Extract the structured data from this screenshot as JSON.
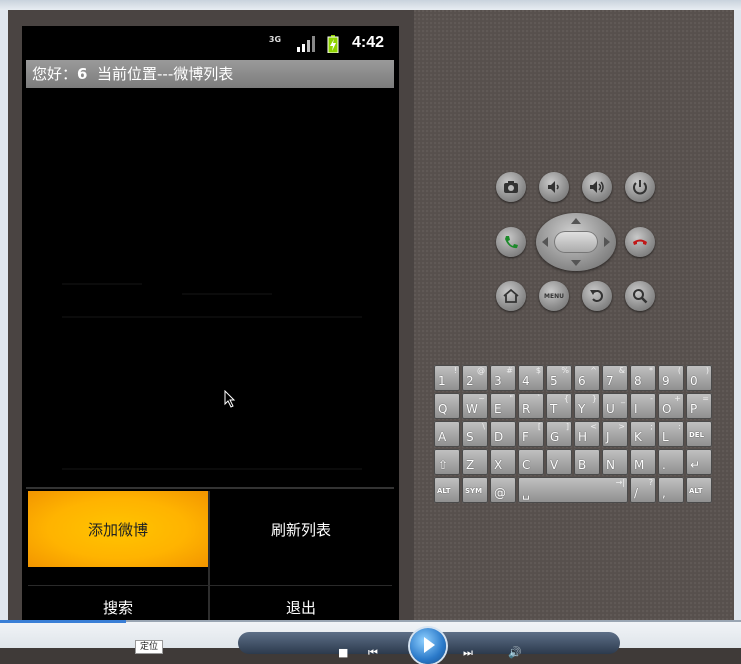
{
  "status_bar": {
    "network": "3G",
    "time": "4:42"
  },
  "title_bar": {
    "greeting": "您好：",
    "user_id": "6",
    "location": "当前位置---微博列表"
  },
  "option_menu": {
    "items": [
      {
        "label": "添加微博",
        "highlighted": true
      },
      {
        "label": "刷新列表",
        "highlighted": false
      },
      {
        "label": "搜索",
        "highlighted": false
      },
      {
        "label": "退出",
        "highlighted": false
      }
    ]
  },
  "emulator_controls": {
    "menu_key_label": "MENU",
    "icons": [
      "camera-icon",
      "volume-down-icon",
      "volume-up-icon",
      "power-icon",
      "call-icon",
      "end-call-icon",
      "home-icon",
      "menu-icon",
      "back-icon",
      "search-icon"
    ]
  },
  "keyboard": {
    "row1": [
      [
        "1",
        "!"
      ],
      [
        "2",
        "@"
      ],
      [
        "3",
        "#"
      ],
      [
        "4",
        "$"
      ],
      [
        "5",
        "%"
      ],
      [
        "6",
        "^"
      ],
      [
        "7",
        "&"
      ],
      [
        "8",
        "*"
      ],
      [
        "9",
        "("
      ],
      [
        "0",
        ")"
      ]
    ],
    "row2": [
      [
        "Q",
        ""
      ],
      [
        "W",
        "~"
      ],
      [
        "E",
        "\""
      ],
      [
        "R",
        "`"
      ],
      [
        "T",
        "{"
      ],
      [
        "Y",
        "}"
      ],
      [
        "U",
        "_"
      ],
      [
        "I",
        "-"
      ],
      [
        "O",
        "+"
      ],
      [
        "P",
        "="
      ]
    ],
    "row3": [
      [
        "A",
        ""
      ],
      [
        "S",
        "\\"
      ],
      [
        "D",
        ""
      ],
      [
        "F",
        "["
      ],
      [
        "G",
        "]"
      ],
      [
        "H",
        "<"
      ],
      [
        "J",
        ">"
      ],
      [
        "K",
        ";"
      ],
      [
        "L",
        ":"
      ],
      [
        "DEL",
        ""
      ]
    ],
    "row4": [
      [
        "⇧",
        ""
      ],
      [
        "Z",
        ""
      ],
      [
        "X",
        ""
      ],
      [
        "C",
        ""
      ],
      [
        "V",
        ""
      ],
      [
        "B",
        ""
      ],
      [
        "N",
        ""
      ],
      [
        "M",
        ""
      ],
      [
        ".",
        ""
      ],
      [
        "↵",
        ""
      ]
    ],
    "row5": [
      [
        "ALT",
        ""
      ],
      [
        "SYM",
        ""
      ],
      [
        "@",
        ""
      ],
      [
        "␣",
        "→|"
      ],
      [
        "/",
        "?"
      ],
      [
        ",",
        ""
      ],
      [
        "ALT",
        ""
      ]
    ]
  },
  "media_bar": {
    "label": "定位",
    "progress": 0.17
  },
  "colors": {
    "menu_highlight": "#ffb300",
    "title_bar": "#888888",
    "screen_bg": "#000000"
  }
}
